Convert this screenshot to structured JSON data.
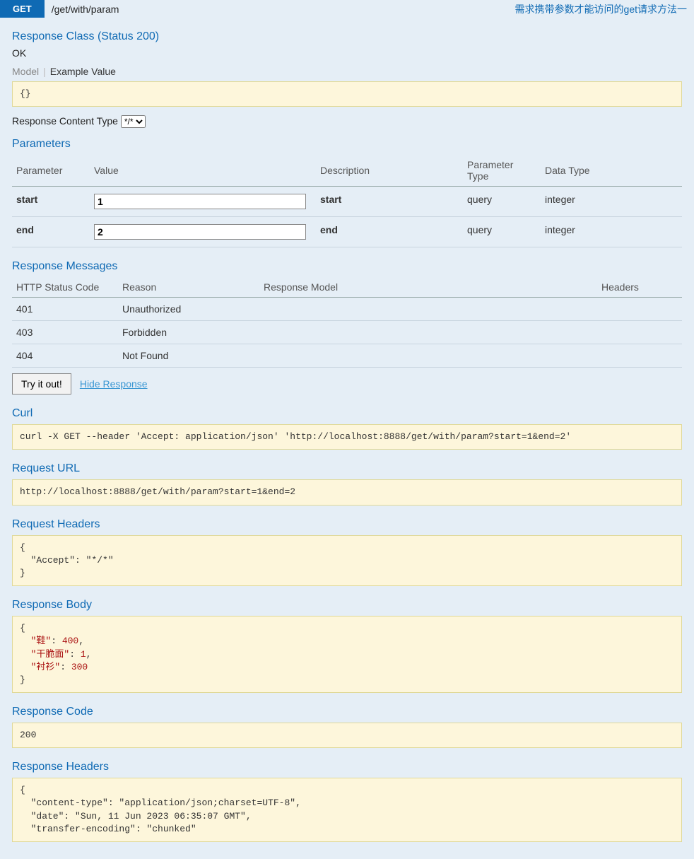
{
  "header": {
    "method": "GET",
    "path": "/get/with/param",
    "description": "需求携带参数才能访问的get请求方法一"
  },
  "responseClass": {
    "title": "Response Class (Status 200)",
    "status": "OK",
    "tabModel": "Model",
    "tabExample": "Example Value",
    "example": "{}"
  },
  "contentType": {
    "label": "Response Content Type",
    "value": "*/*"
  },
  "parameters": {
    "title": "Parameters",
    "cols": {
      "parameter": "Parameter",
      "value": "Value",
      "description": "Description",
      "ptype": "Parameter Type",
      "dtype": "Data Type"
    },
    "rows": [
      {
        "name": "start",
        "value": "1",
        "desc": "start",
        "ptype": "query",
        "dtype": "integer"
      },
      {
        "name": "end",
        "value": "2",
        "desc": "end",
        "ptype": "query",
        "dtype": "integer"
      }
    ]
  },
  "responseMessages": {
    "title": "Response Messages",
    "cols": {
      "code": "HTTP Status Code",
      "reason": "Reason",
      "model": "Response Model",
      "headers": "Headers"
    },
    "rows": [
      {
        "code": "401",
        "reason": "Unauthorized"
      },
      {
        "code": "403",
        "reason": "Forbidden"
      },
      {
        "code": "404",
        "reason": "Not Found"
      }
    ]
  },
  "actions": {
    "tryLabel": "Try it out!",
    "hideLabel": "Hide Response"
  },
  "curl": {
    "title": "Curl",
    "body": "curl -X GET --header 'Accept: application/json' 'http://localhost:8888/get/with/param?start=1&end=2'"
  },
  "requestUrl": {
    "title": "Request URL",
    "body": "http://localhost:8888/get/with/param?start=1&end=2"
  },
  "requestHeaders": {
    "title": "Request Headers",
    "body": "{\n  \"Accept\": \"*/*\"\n}"
  },
  "responseBody": {
    "title": "Response Body",
    "lines": [
      {
        "t": "{"
      },
      {
        "k": "\"鞋\"",
        "v": "400",
        "comma": true
      },
      {
        "k": "\"干脆面\"",
        "v": "1",
        "comma": true
      },
      {
        "k": "\"衬衫\"",
        "v": "300",
        "comma": false
      },
      {
        "t": "}"
      }
    ]
  },
  "responseCode": {
    "title": "Response Code",
    "body": "200"
  },
  "responseHeaders": {
    "title": "Response Headers",
    "body": "{\n  \"content-type\": \"application/json;charset=UTF-8\",\n  \"date\": \"Sun, 11 Jun 2023 06:35:07 GMT\",\n  \"transfer-encoding\": \"chunked\""
  }
}
